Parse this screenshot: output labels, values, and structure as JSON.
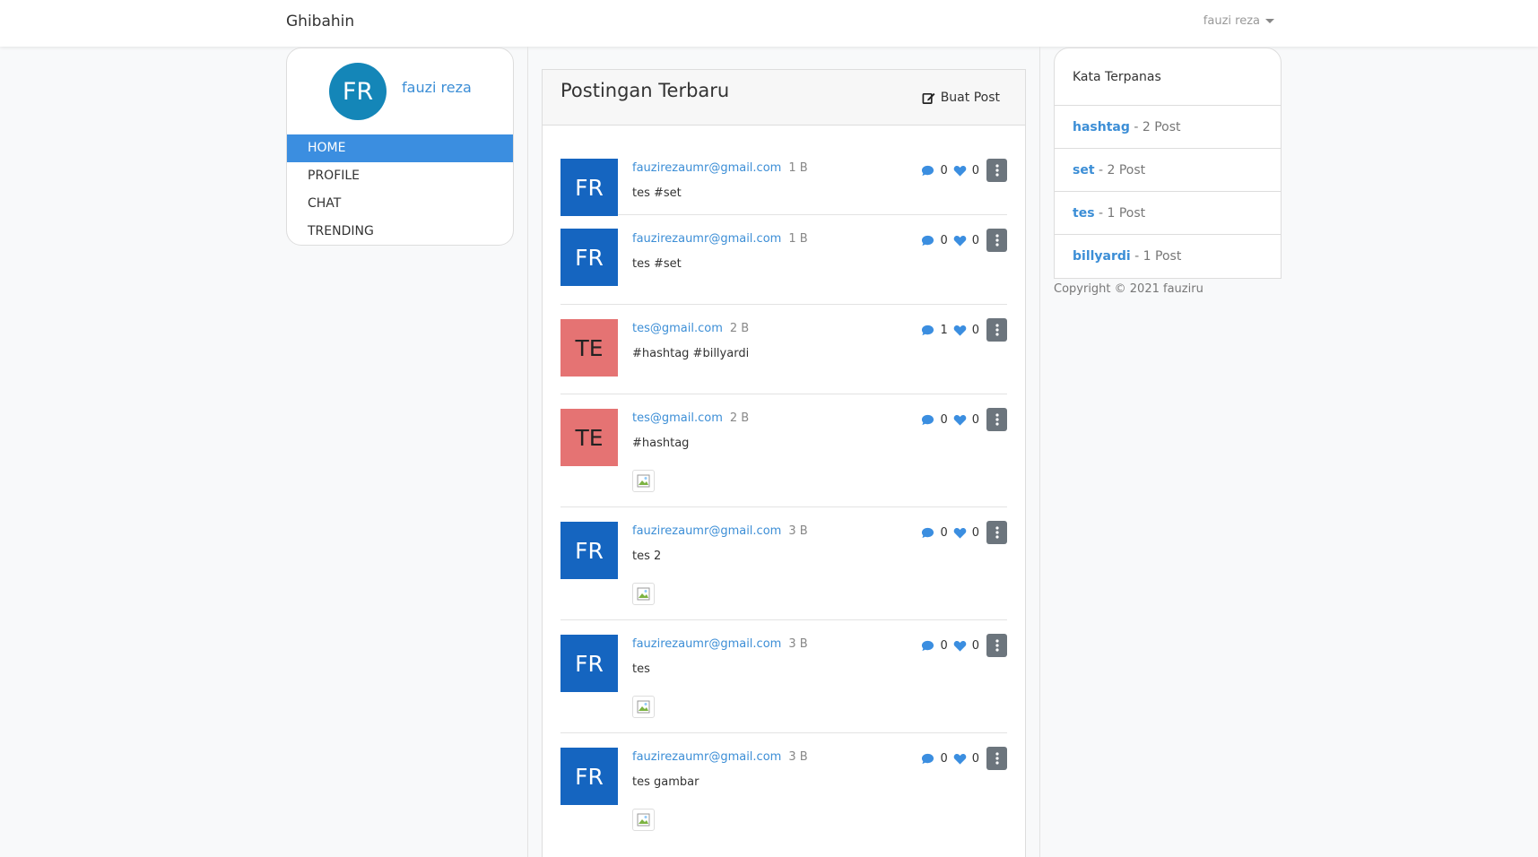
{
  "navbar": {
    "brand": "Ghibahin",
    "user_name": "fauzi reza"
  },
  "profile": {
    "initials": "FR",
    "name": "fauzi reza",
    "avatar_color": "#1486b8"
  },
  "menu": [
    {
      "label": "HOME",
      "active": true
    },
    {
      "label": "PROFILE",
      "active": false
    },
    {
      "label": "CHAT",
      "active": false
    },
    {
      "label": "TRENDING",
      "active": false
    }
  ],
  "feed": {
    "title": "Postingan Terbaru",
    "new_post_label": "Buat Post",
    "posts": [
      {
        "initials": "FR",
        "avatar": "blue",
        "author": "fauzirezaumr@gmail.com",
        "time": "1 B",
        "text": "tes #set",
        "comments": "0",
        "likes": "0",
        "has_image": false
      },
      {
        "initials": "FR",
        "avatar": "blue",
        "author": "fauzirezaumr@gmail.com",
        "time": "1 B",
        "text": "tes #set",
        "comments": "0",
        "likes": "0",
        "has_image": false
      },
      {
        "initials": "TE",
        "avatar": "red",
        "author": "tes@gmail.com",
        "time": "2 B",
        "text": "#hashtag #billyardi",
        "comments": "1",
        "likes": "0",
        "has_image": false
      },
      {
        "initials": "TE",
        "avatar": "red",
        "author": "tes@gmail.com",
        "time": "2 B",
        "text": "#hashtag",
        "comments": "0",
        "likes": "0",
        "has_image": true
      },
      {
        "initials": "FR",
        "avatar": "blue",
        "author": "fauzirezaumr@gmail.com",
        "time": "3 B",
        "text": "tes 2",
        "comments": "0",
        "likes": "0",
        "has_image": true
      },
      {
        "initials": "FR",
        "avatar": "blue",
        "author": "fauzirezaumr@gmail.com",
        "time": "3 B",
        "text": "tes",
        "comments": "0",
        "likes": "0",
        "has_image": true
      },
      {
        "initials": "FR",
        "avatar": "blue",
        "author": "fauzirezaumr@gmail.com",
        "time": "3 B",
        "text": "tes gambar",
        "comments": "0",
        "likes": "0",
        "has_image": true
      }
    ]
  },
  "trending": {
    "title": "Kata Terpanas",
    "items": [
      {
        "tag": "hashtag",
        "count": "- 2 Post"
      },
      {
        "tag": "set",
        "count": "- 2 Post"
      },
      {
        "tag": "tes",
        "count": "- 1 Post"
      },
      {
        "tag": "billyardi",
        "count": "- 1 Post"
      }
    ]
  },
  "footer": {
    "copyright": "Copyright © 2021 fauziru"
  },
  "colors": {
    "accent": "#3b8ee0",
    "link": "#3c8ed6",
    "avatar_blue": "#1565c0",
    "avatar_red": "#e57373",
    "more_button": "#6c757d"
  },
  "icons": {
    "edit": "edit-icon",
    "comment": "comment-icon",
    "like": "heart-icon",
    "more": "kebab-icon",
    "image": "broken-image-icon"
  }
}
